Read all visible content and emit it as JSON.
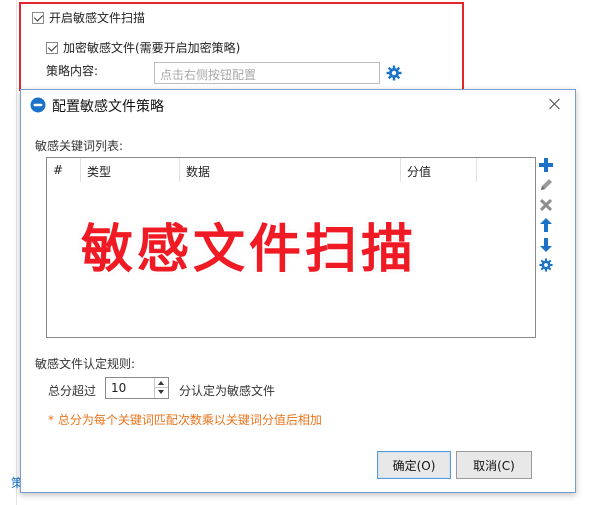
{
  "settings": {
    "enable_sensitive_scan_label": "开启敏感文件扫描",
    "encrypt_sensitive_label": "加密敏感文件(需要开启加密策略)",
    "policy_content_label": "策略内容:",
    "policy_content_placeholder": "点击右侧按钮配置",
    "bottom_partial_text": "策",
    "enable_sensitive_scan_checked": true,
    "encrypt_sensitive_checked": true
  },
  "dialog": {
    "title": "配置敏感文件策略",
    "keyword_list_label": "敏感关键词列表:",
    "table_headers": [
      "#",
      "类型",
      "数据",
      "分值"
    ],
    "watermark": "敏感文件扫描",
    "rule_label": "敏感文件认定规则:",
    "total_score_label": "总分超过",
    "threshold_value": "10",
    "threshold_suffix": "分认定为敏感文件",
    "note": "* 总分为每个关键词匹配次数乘以关键词分值后相加",
    "ok_button": "确定(O)",
    "cancel_button": "取消(C)"
  },
  "icons": {
    "side_tools": [
      "add-icon",
      "edit-icon",
      "delete-icon",
      "move-up-icon",
      "move-down-icon",
      "settings-icon"
    ]
  },
  "colors": {
    "accent_blue": "#1a73c9",
    "highlight_red": "#e3262e",
    "watermark_red": "#ef1a23",
    "note_orange": "#e8741d"
  }
}
